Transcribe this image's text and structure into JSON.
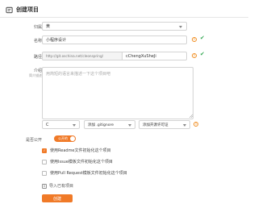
{
  "header": {
    "title": "创建项目"
  },
  "form": {
    "owner": {
      "label": "归属",
      "value": "黄"
    },
    "name": {
      "label": "名称",
      "value": "小程序设计"
    },
    "path": {
      "label": "路径",
      "prefix": "http://git.oschina.net/cleonspring/",
      "value": "cChengXuSheJi"
    },
    "intro": {
      "label": "介绍",
      "sublabel": "简介描述",
      "placeholder": "用简短的语言来描述一下这个项目吧"
    },
    "language": {
      "value": "C"
    },
    "gitignore": {
      "value": "添加 .gitignore"
    },
    "license": {
      "value": "添加开源许可证"
    },
    "public": {
      "label": "是否公开",
      "toggle_label": "公开的"
    },
    "options": [
      {
        "label": "使用Readme文件初始化这个项目",
        "checked": true
      },
      {
        "label": "使用Issue模板文件初始化这个项目",
        "checked": false
      },
      {
        "label": "使用Pull Request模板文件初始化这个项目",
        "checked": false
      }
    ],
    "import_label": "导入已有项目",
    "submit_label": "创建"
  },
  "icons": {
    "header": "project-icon",
    "warning": "warning-icon",
    "valid": "check-icon",
    "import": "import-icon"
  },
  "colors": {
    "accent": "#f07a28",
    "valid": "#3cab5a",
    "warning": "#f08c1e"
  }
}
